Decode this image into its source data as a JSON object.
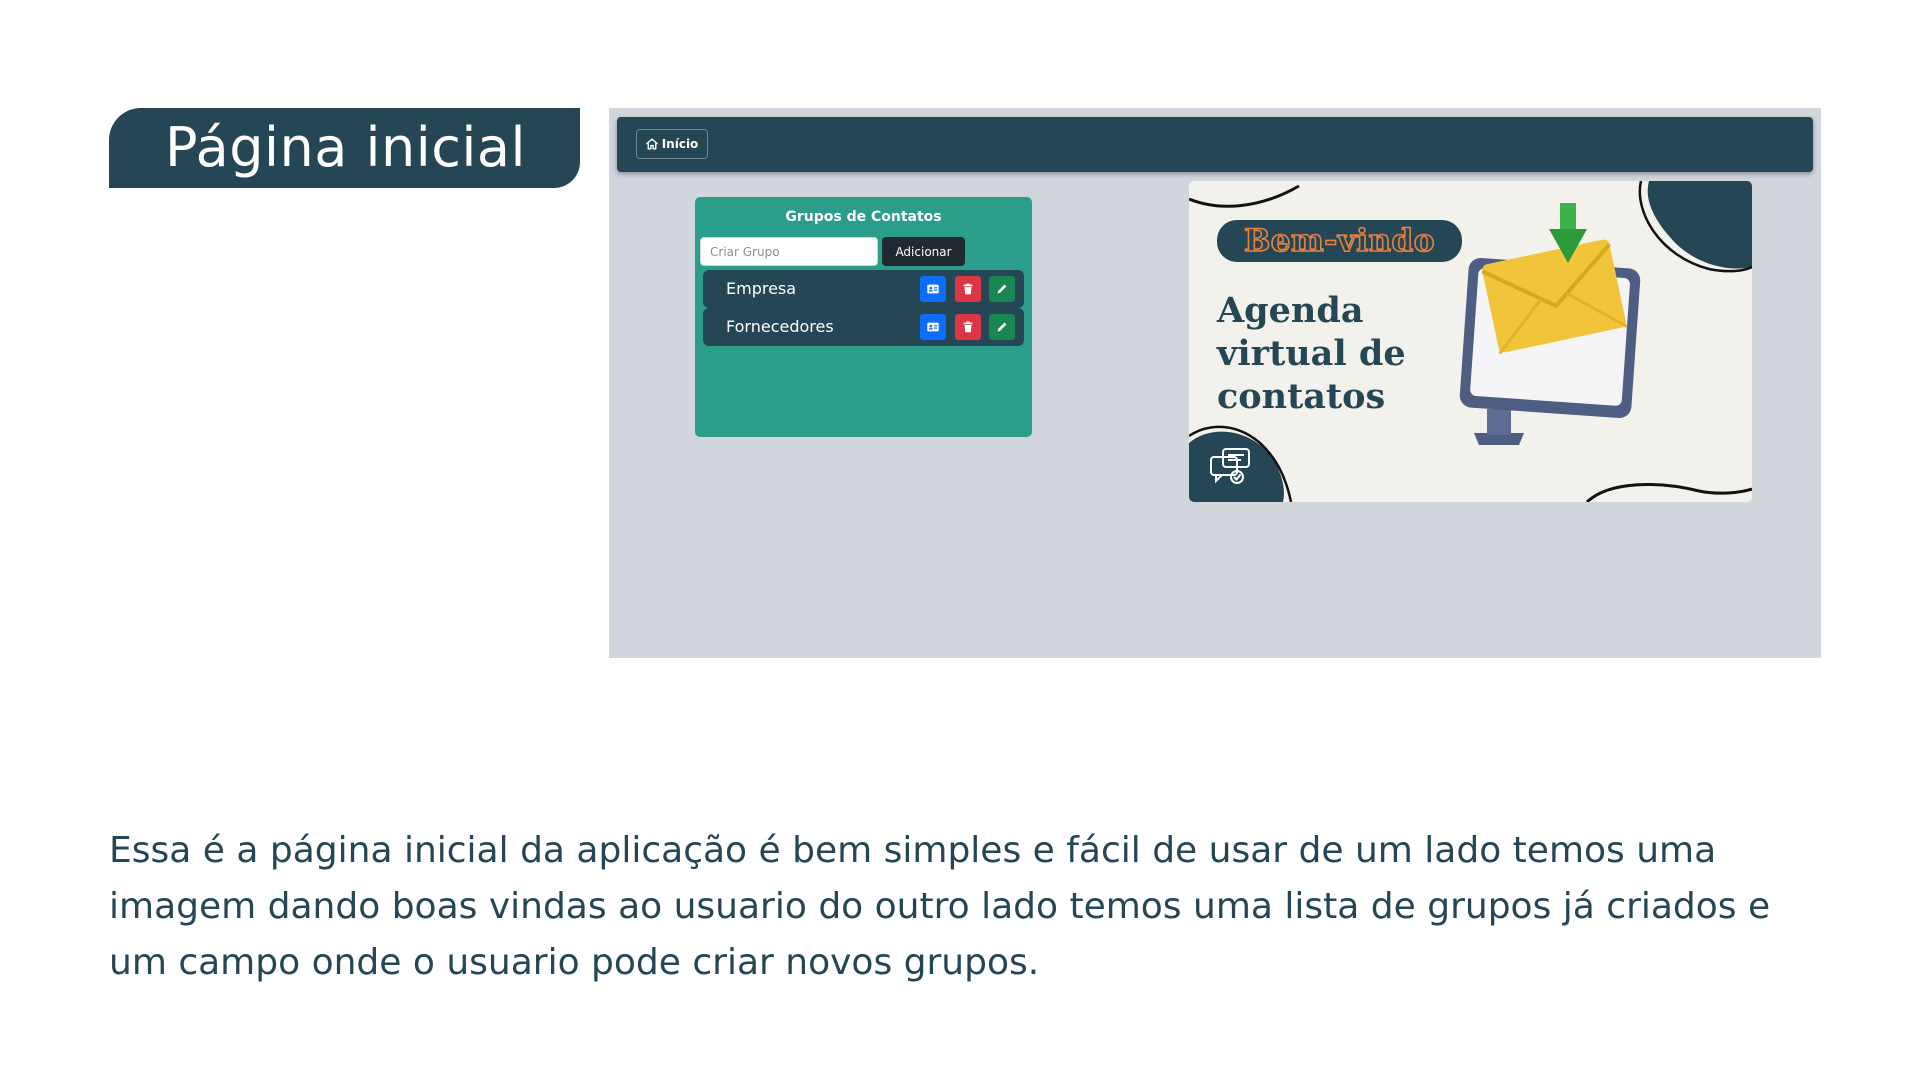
{
  "slide": {
    "title": "Página inicial",
    "description": "Essa é a página inicial da aplicação é bem simples e fácil de usar de um lado temos uma imagem dando boas vindas ao usuario do outro lado temos uma lista de grupos já criados e um campo onde o usuario pode criar novos grupos."
  },
  "app": {
    "navbar": {
      "home_label": "Início",
      "home_icon": "house-icon"
    },
    "groups_panel": {
      "title": "Grupos de Contatos",
      "create_input": {
        "placeholder": "Criar Grupo",
        "value": ""
      },
      "add_button_label": "Adicionar",
      "groups": [
        {
          "name": "Empresa"
        },
        {
          "name": "Fornecedores"
        }
      ],
      "row_actions": [
        {
          "icon": "id-card-icon",
          "color": "#0d6efd"
        },
        {
          "icon": "trash-icon",
          "color": "#dc3545"
        },
        {
          "icon": "pencil-icon",
          "color": "#198754"
        }
      ]
    },
    "welcome_banner": {
      "badge_text": "Bem-vindo",
      "headline_lines": [
        "Agenda",
        "virtual de",
        "contatos"
      ],
      "icons": [
        "envelope-icon",
        "monitor-icon",
        "download-arrow-icon",
        "chat-bubbles-icon"
      ]
    }
  },
  "colors": {
    "primary_dark": "#254654",
    "panel_teal": "#2a9d8b",
    "background_gray": "#d1d5dc",
    "badge_orange": "#e8813f"
  }
}
